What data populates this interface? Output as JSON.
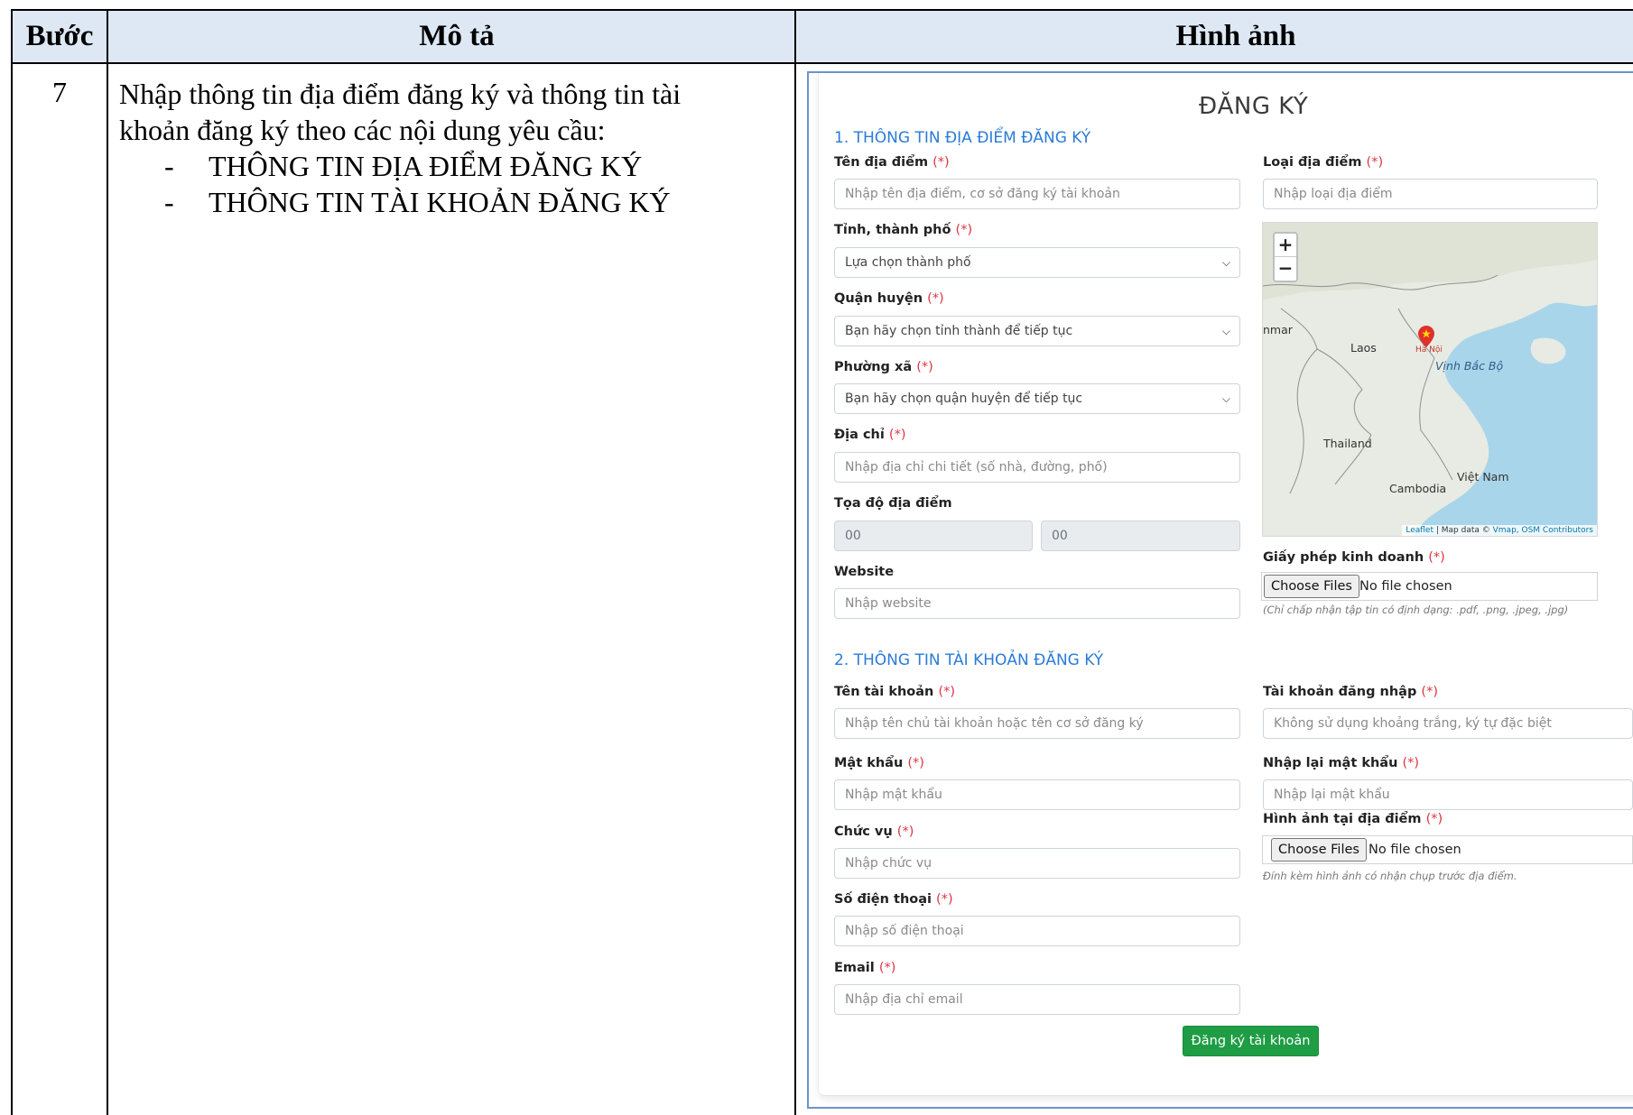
{
  "table": {
    "headers": {
      "step": "Bước",
      "description": "Mô tả",
      "image": "Hình ảnh"
    },
    "row": {
      "step": "7",
      "description_line1": "Nhập thông tin địa điểm đăng ký và thông tin tài",
      "description_line2": "khoản đăng ký theo các nội dung yêu cầu:",
      "bullets": [
        {
          "dash": "-",
          "text": "THÔNG TIN ĐỊA ĐIỂM ĐĂNG KÝ"
        },
        {
          "dash": "-",
          "text": "THÔNG TIN TÀI KHOẢN ĐĂNG KÝ"
        }
      ]
    }
  },
  "form": {
    "title": "ĐĂNG KÝ",
    "required_mark": "(*)",
    "section1_title": "1. THÔNG TIN ĐỊA ĐIỂM ĐĂNG KÝ",
    "section2_title": "2. THÔNG TIN TÀI KHOẢN ĐĂNG KÝ",
    "location_name": {
      "label": "Tên địa điểm",
      "placeholder": "Nhập tên địa điểm, cơ sở đăng ký tài khoản"
    },
    "location_type": {
      "label": "Loại địa điểm",
      "placeholder": "Nhập loại địa điểm"
    },
    "province": {
      "label": "Tỉnh, thành phố",
      "value": "Lựa chọn thành phố"
    },
    "district": {
      "label": "Quận huyện",
      "value": "Bạn hãy chọn tỉnh thành để tiếp tục"
    },
    "ward": {
      "label": "Phường xã",
      "value": "Bạn hãy chọn quận huyện để tiếp tục"
    },
    "address": {
      "label": "Địa chỉ",
      "placeholder": "Nhập địa chỉ chi tiết (số nhà, đường, phố)"
    },
    "coordinates": {
      "label": "Tọa độ địa điểm",
      "lat": "00",
      "lng": "00"
    },
    "website": {
      "label": "Website",
      "placeholder": "Nhập website"
    },
    "business_license": {
      "label": "Giấy phép kinh doanh",
      "button": "Choose Files",
      "status": "No file chosen",
      "hint": "(Chỉ chấp nhận tập tin có định dạng: .pdf, .png, .jpeg, .jpg)"
    },
    "account_name": {
      "label": "Tên tài khoản",
      "placeholder": "Nhập tên chủ tài khoản hoặc tên cơ sở đăng ký"
    },
    "login": {
      "label": "Tài khoản đăng nhập",
      "placeholder": "Không sử dụng khoảng trắng, ký tự đặc biệt"
    },
    "password": {
      "label": "Mật khẩu",
      "placeholder": "Nhập mật khẩu"
    },
    "password_confirm": {
      "label": "Nhập lại mật khẩu",
      "placeholder": "Nhập lại mật khẩu"
    },
    "position": {
      "label": "Chức vụ",
      "placeholder": "Nhập chức vụ"
    },
    "site_images": {
      "label": "Hình ảnh tại địa điểm",
      "button": "Choose Files",
      "status": "No file chosen",
      "hint": "Đính kèm hình ảnh có nhận chụp trước địa điểm."
    },
    "phone": {
      "label": "Số điện thoại",
      "placeholder": "Nhập số điện thoại"
    },
    "email": {
      "label": "Email",
      "placeholder": "Nhập địa chỉ email"
    },
    "submit_label": "Đăng ký tài khoản"
  },
  "map": {
    "zoom_in": "+",
    "zoom_out": "−",
    "labels": {
      "myanmar": "nmar",
      "laos": "Laos",
      "hanoi": "Hà Nội",
      "gulf": "Vịnh Bắc Bộ",
      "thailand": "Thailand",
      "vietnam": "Việt Nam",
      "cambodia": "Cambodia"
    },
    "attribution_leaflet": "Leaflet",
    "attribution_sep": " | Map data © ",
    "attribution_sources": "Vmap, OSM Contributors"
  },
  "colors": {
    "header_bg": "#dde8f4",
    "section_blue": "#2a7bd6",
    "required_red": "#dc3545",
    "submit_green": "#1f9d45",
    "frame_blue": "#6a94cc"
  }
}
